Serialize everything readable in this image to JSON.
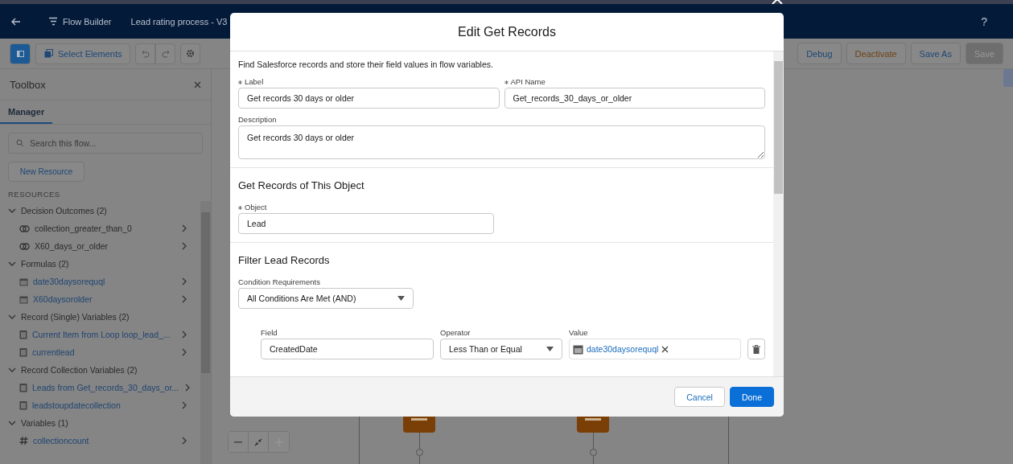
{
  "header": {
    "title": "Flow Builder",
    "flow_name": "Lead rating process - V3",
    "help": "?"
  },
  "toolbar": {
    "select_elements": "Select Elements",
    "buttons": [
      {
        "label": "Debug",
        "kind": "link"
      },
      {
        "label": "Deactivate",
        "kind": "warning"
      },
      {
        "label": "Save As",
        "kind": "link"
      },
      {
        "label": "Save",
        "kind": "disabled"
      }
    ]
  },
  "toolbox": {
    "title": "Toolbox",
    "tabs": [
      {
        "label": "Manager",
        "selected": true
      }
    ],
    "search": {
      "placeholder": "Search this flow..."
    },
    "new_resource": "New Resource",
    "section": "RESOURCES",
    "groups": [
      {
        "label": "Decision Outcomes (2)",
        "expanded": true,
        "children": [
          {
            "label": "collection_greater_than_0",
            "kind": "outcome"
          },
          {
            "label": "X60_days_or_older",
            "kind": "outcome"
          }
        ]
      },
      {
        "label": "Formulas (2)",
        "expanded": true,
        "children": [
          {
            "label": "date30daysorequql",
            "kind": "formula"
          },
          {
            "label": "X60daysorolder",
            "kind": "formula"
          }
        ]
      },
      {
        "label": "Record (Single) Variables (2)",
        "expanded": true,
        "children": [
          {
            "label": "Current Item from Loop loop_lead_...",
            "kind": "record"
          },
          {
            "label": "currentlead",
            "kind": "record"
          }
        ]
      },
      {
        "label": "Record Collection Variables (2)",
        "expanded": true,
        "children": [
          {
            "label": "Leads from Get_records_30_days_or...",
            "kind": "record"
          },
          {
            "label": "leadstoupdatecollection",
            "kind": "record"
          }
        ]
      },
      {
        "label": "Variables (1)",
        "expanded": true,
        "children": [
          {
            "label": "collectioncount",
            "kind": "number"
          }
        ]
      }
    ]
  },
  "modal": {
    "title": "Edit Get Records",
    "intro": "Find Salesforce records and store their field values in flow variables.",
    "label": {
      "label": "Label",
      "required": true,
      "value": "Get records 30 days or older"
    },
    "api_name": {
      "label": "API Name",
      "required": true,
      "value": "Get_records_30_days_or_older"
    },
    "description": {
      "label": "Description",
      "required": false,
      "value": "Get records 30 days or older"
    },
    "object_section": {
      "title": "Get Records of This Object",
      "object": {
        "label": "Object",
        "required": true,
        "value": "Lead"
      }
    },
    "filter_section": {
      "title": "Filter Lead Records",
      "condition_requirements": {
        "label": "Condition Requirements",
        "value": "All Conditions Are Met (AND)"
      },
      "conditions": [
        {
          "field_label": "Field",
          "field": "CreatedDate",
          "operator_label": "Operator",
          "operator": "Less Than or Equal",
          "value_label": "Value",
          "value": "date30daysorequql"
        }
      ]
    },
    "buttons": {
      "cancel": "Cancel",
      "done": "Done"
    }
  }
}
